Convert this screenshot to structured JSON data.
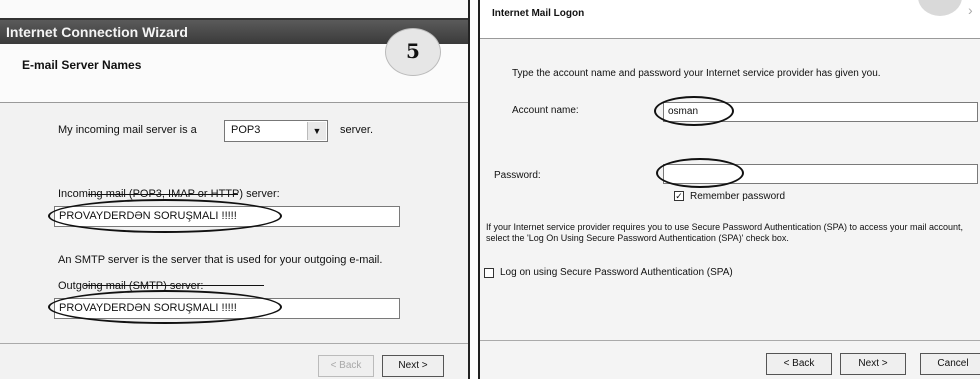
{
  "left": {
    "title_bar": "Internet Connection Wizard",
    "step_badge": "5",
    "section_title": "E-mail Server Names",
    "incoming_prefix": "My incoming mail server is a",
    "server_type": "POP3",
    "server_suffix": "server.",
    "incoming_label": "Incoming mail (POP3, IMAP or HTTP) server:",
    "incoming_value": "PROVAYDERDƏN SORUŞMALI !!!!!",
    "smtp_note": "An SMTP server is the server that is used for your outgoing e-mail.",
    "outgoing_label": "Outgoing mail (SMTP) server:",
    "outgoing_value": "PROVAYDERDƏN SORUŞMALI !!!!!",
    "back_button": "< Back",
    "next_button": "Next >"
  },
  "right": {
    "section_title": "Internet Mail Logon",
    "intro": "Type the account name and password your Internet service provider has given you.",
    "account_label": "Account name:",
    "account_value": "osman",
    "password_label": "Password:",
    "password_value": "",
    "remember_label": "Remember password",
    "remember_checked": true,
    "spa_note": "If your Internet service provider requires you to use Secure Password Authentication (SPA) to access your mail account, select the 'Log On Using Secure Password Authentication (SPA)' check box.",
    "spa_label": "Log on using Secure Password Authentication (SPA)",
    "spa_checked": false,
    "back_button": "< Back",
    "next_button": "Next >",
    "cancel_button": "Cancel"
  },
  "icons": {
    "server_dropdown": "chevron-down-icon",
    "remember_check": "checkmark-icon",
    "forward": "chevron-right-icon"
  }
}
